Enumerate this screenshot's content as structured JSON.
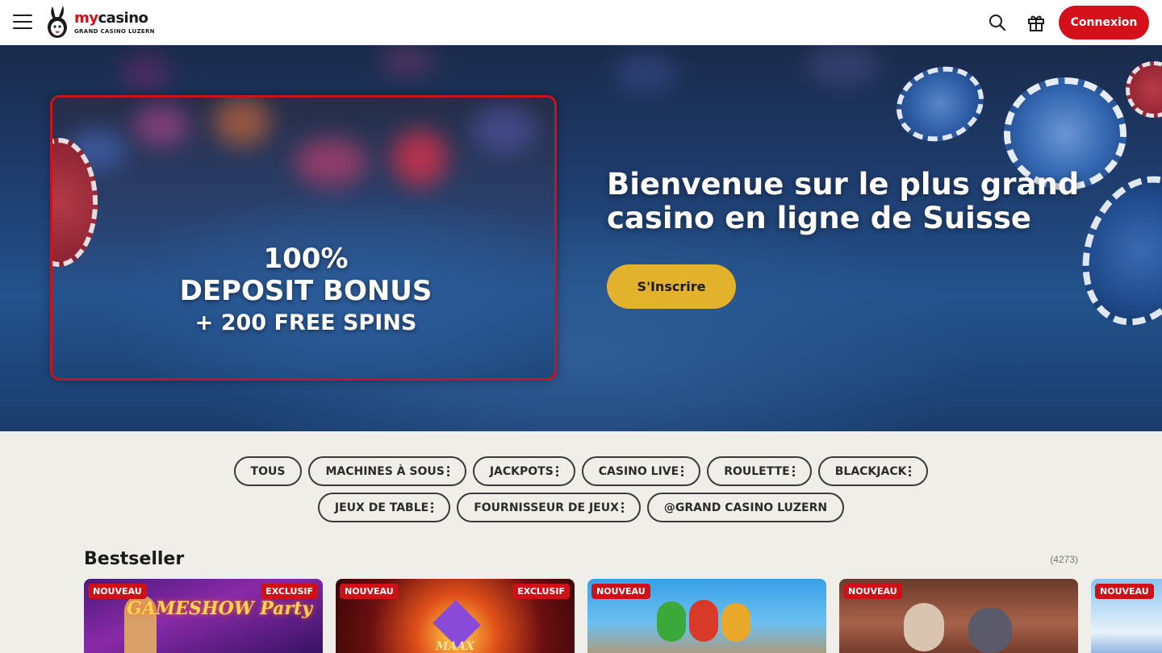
{
  "header": {
    "logo_name_prefix": "my",
    "logo_name_suffix": "casino",
    "logo_subtitle": "GRAND CASINO LUZERN",
    "login_label": "Connexion",
    "icons": [
      "menu-icon",
      "search-icon",
      "gift-icon"
    ]
  },
  "hero": {
    "promo_line1": "100%",
    "promo_line2": "DEPOSIT BONUS",
    "promo_line3": "+ 200 FREE SPINS",
    "title": "Bienvenue sur le plus grand casino en ligne de Suisse",
    "signup_label": "S'Inscrire"
  },
  "filters": {
    "row1": [
      {
        "label": "TOUS",
        "menu": false
      },
      {
        "label": "MACHINES À SOUS",
        "menu": true
      },
      {
        "label": "JACKPOTS",
        "menu": true
      },
      {
        "label": "CASINO LIVE",
        "menu": true
      },
      {
        "label": "ROULETTE",
        "menu": true
      },
      {
        "label": "BLACKJACK",
        "menu": true
      }
    ],
    "row2": [
      {
        "label": "JEUX DE TABLE",
        "menu": true
      },
      {
        "label": "FOURNISSEUR DE JEUX",
        "menu": true
      },
      {
        "label": "@GRAND CASINO LUZERN",
        "menu": false
      }
    ]
  },
  "bestseller": {
    "title": "Bestseller",
    "count": "(4273)",
    "games": [
      {
        "badge_new": "NOUVEAU",
        "badge_ex": "EXCLUSIF",
        "title": "GAMESHOW Party"
      },
      {
        "badge_new": "NOUVEAU",
        "badge_ex": "EXCLUSIF",
        "title": "MAAX"
      },
      {
        "badge_new": "NOUVEAU",
        "badge_ex": "",
        "title": ""
      },
      {
        "badge_new": "NOUVEAU",
        "badge_ex": "",
        "title": ""
      },
      {
        "badge_new": "NOUVEAU",
        "badge_ex": "",
        "title": ""
      }
    ]
  },
  "colors": {
    "brand_red": "#d4101a",
    "signup_yellow": "#e3b22c",
    "page_bg": "#efeee8"
  }
}
